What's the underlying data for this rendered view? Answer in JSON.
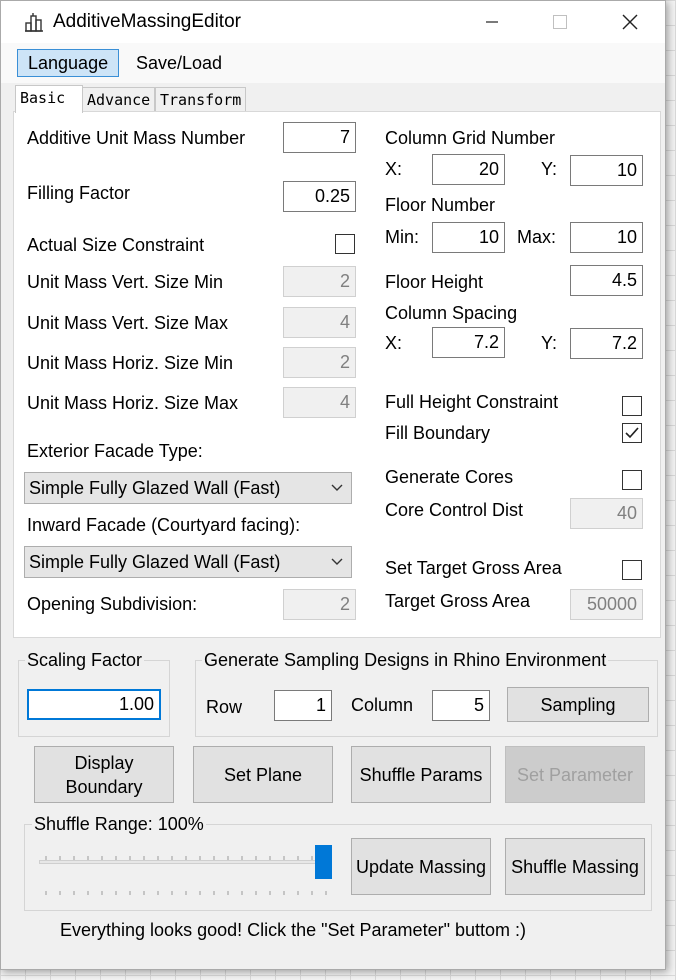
{
  "window": {
    "title": "AdditiveMassingEditor"
  },
  "menu": {
    "items": [
      "Language",
      "Save/Load"
    ]
  },
  "tabs": [
    "Basic",
    "Advance",
    "Transform"
  ],
  "basic": {
    "additive_unit_mass_number": {
      "label": "Additive Unit Mass Number",
      "value": "7"
    },
    "filling_factor": {
      "label": "Filling Factor",
      "value": "0.25"
    },
    "actual_size_constraint": {
      "label": "Actual Size Constraint",
      "checked": false
    },
    "unit_mass_vert_min": {
      "label": "Unit Mass Vert. Size Min",
      "value": "2"
    },
    "unit_mass_vert_max": {
      "label": "Unit Mass Vert. Size Max",
      "value": "4"
    },
    "unit_mass_horiz_min": {
      "label": "Unit Mass Horiz. Size Min",
      "value": "2"
    },
    "unit_mass_horiz_max": {
      "label": "Unit Mass Horiz. Size Max",
      "value": "4"
    },
    "exterior_facade": {
      "label": "Exterior Facade Type:",
      "value": "Simple Fully Glazed Wall (Fast)"
    },
    "inward_facade": {
      "label": "Inward Facade (Courtyard facing):",
      "value": "Simple Fully Glazed Wall (Fast)"
    },
    "opening_subdivision": {
      "label": "Opening Subdivision:",
      "value": "2"
    },
    "column_grid": {
      "label": "Column Grid Number",
      "x_label": "X:",
      "x": "20",
      "y_label": "Y:",
      "y": "10"
    },
    "floor_number": {
      "label": "Floor Number",
      "min_label": "Min:",
      "min": "10",
      "max_label": "Max:",
      "max": "10"
    },
    "floor_height": {
      "label": "Floor Height",
      "value": "4.5"
    },
    "column_spacing": {
      "label": "Column Spacing",
      "x_label": "X:",
      "x": "7.2",
      "y_label": "Y:",
      "y": "7.2"
    },
    "full_height_constraint": {
      "label": "Full Height Constraint",
      "checked": false
    },
    "fill_boundary": {
      "label": "Fill Boundary",
      "checked": true
    },
    "generate_cores": {
      "label": "Generate Cores",
      "checked": false
    },
    "core_control_dist": {
      "label": "Core Control Dist",
      "value": "40"
    },
    "set_target_gross_area": {
      "label": "Set Target Gross Area",
      "checked": false
    },
    "target_gross_area": {
      "label": "Target Gross Area",
      "value": "50000"
    }
  },
  "scaling": {
    "title": "Scaling Factor",
    "value": "1.00"
  },
  "sampling": {
    "title": "Generate Sampling Designs in Rhino Environment",
    "row_label": "Row",
    "row": "1",
    "column_label": "Column",
    "column": "5",
    "button": "Sampling"
  },
  "buttons": {
    "display_boundary": "Display Boundary",
    "set_plane": "Set Plane",
    "shuffle_params": "Shuffle Params",
    "set_parameter": "Set Parameter"
  },
  "shuffle": {
    "title": "Shuffle Range: 100%",
    "range_fraction": 1.0,
    "update_massing": "Update Massing",
    "shuffle_massing": "Shuffle Massing"
  },
  "status": "Everything looks good! Click the \"Set Parameter\" buttom :)",
  "colors": {
    "accent": "#0078d7",
    "menu_highlight": "#cde4f7"
  }
}
